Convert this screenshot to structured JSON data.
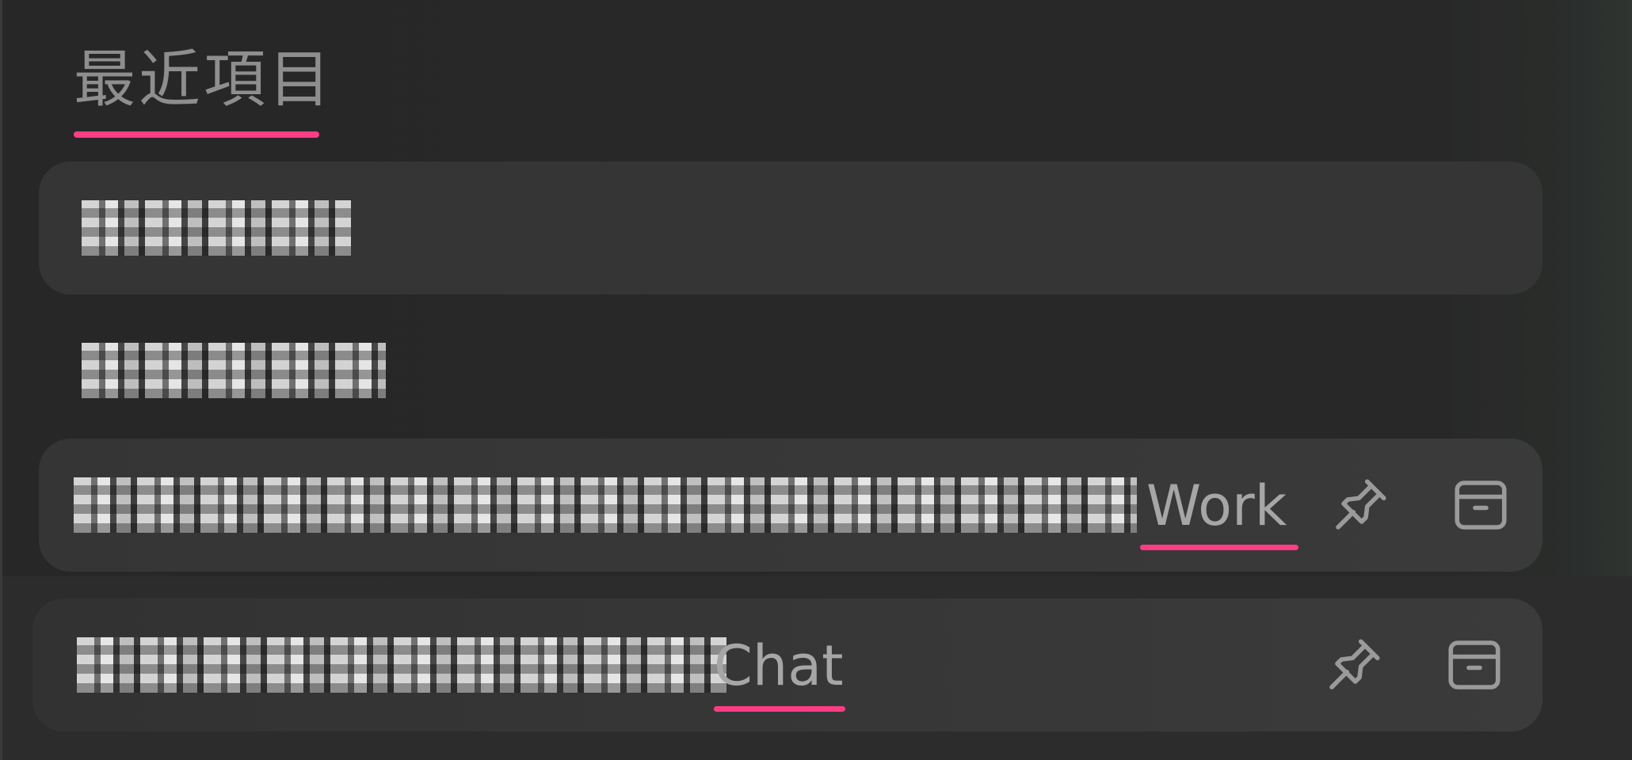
{
  "section": {
    "title": "最近項目"
  },
  "items": [
    {
      "label": "████████",
      "tag": ""
    },
    {
      "label": "████████",
      "tag": ""
    },
    {
      "label": "████████████████████████████",
      "tag": "Work"
    },
    {
      "label": "██████████████",
      "tag": "Chat"
    }
  ],
  "icons": {
    "pin": "pin-icon",
    "archive": "archive-icon"
  },
  "colors": {
    "accent": "#ff3d85",
    "background": "#272727",
    "item_bg": "#353535",
    "muted_text": "#8e8e8e",
    "tag_text": "#a6a6a6"
  }
}
